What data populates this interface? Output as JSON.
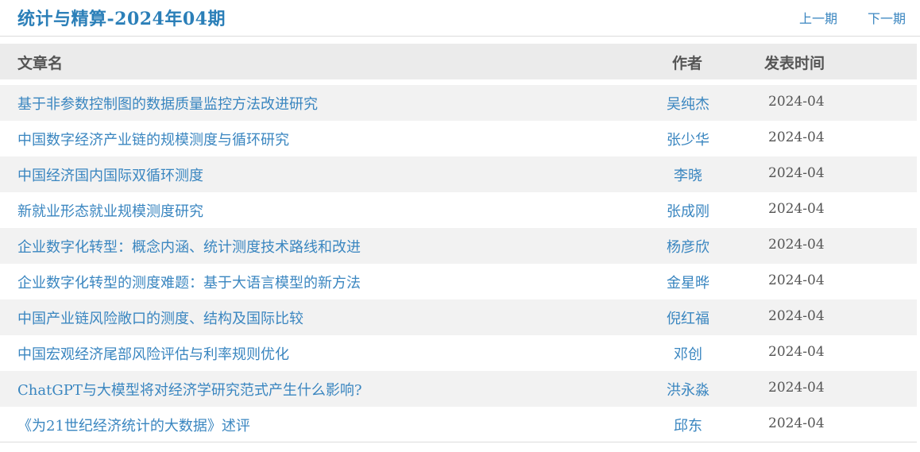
{
  "header": {
    "title": "统计与精算-2024年04期",
    "prev_label": "上一期",
    "next_label": "下一期"
  },
  "table": {
    "columns": {
      "title": "文章名",
      "author": "作者",
      "date": "发表时间"
    },
    "rows": [
      {
        "title": "基于非参数控制图的数据质量监控方法改进研究",
        "author": "吴纯杰",
        "date": "2024-04"
      },
      {
        "title": "中国数字经济产业链的规模测度与循环研究",
        "author": "张少华",
        "date": "2024-04"
      },
      {
        "title": "中国经济国内国际双循环测度",
        "author": "李晓",
        "date": "2024-04"
      },
      {
        "title": "新就业形态就业规模测度研究",
        "author": "张成刚",
        "date": "2024-04"
      },
      {
        "title": "企业数字化转型：概念内涵、统计测度技术路线和改进",
        "author": "杨彦欣",
        "date": "2024-04"
      },
      {
        "title": "企业数字化转型的测度难题：基于大语言模型的新方法",
        "author": "金星晔",
        "date": "2024-04"
      },
      {
        "title": "中国产业链风险敞口的测度、结构及国际比较",
        "author": "倪红福",
        "date": "2024-04"
      },
      {
        "title": "中国宏观经济尾部风险评估与利率规则优化",
        "author": "邓创",
        "date": "2024-04"
      },
      {
        "title": "ChatGPT与大模型将对经济学研究范式产生什么影响?",
        "author": "洪永淼",
        "date": "2024-04"
      },
      {
        "title": "《为21世纪经济统计的大数据》述评",
        "author": "邱东",
        "date": "2024-04"
      }
    ]
  }
}
